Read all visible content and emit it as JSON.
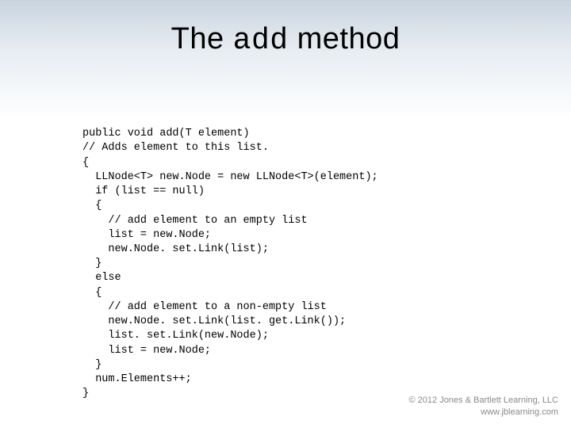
{
  "title": {
    "part1": "The ",
    "code": "add",
    "part2": " method"
  },
  "code_lines": [
    "public void add(T element)",
    "// Adds element to this list.",
    "{",
    "  LLNode<T> new.Node = new LLNode<T>(element);",
    "  if (list == null)",
    "  {",
    "    // add element to an empty list",
    "    list = new.Node;",
    "    new.Node. set.Link(list);",
    "  }",
    "  else",
    "  {",
    "    // add element to a non-empty list",
    "    new.Node. set.Link(list. get.Link());",
    "    list. set.Link(new.Node);",
    "    list = new.Node;",
    "  }",
    "  num.Elements++;",
    "}"
  ],
  "footer": {
    "line1": "© 2012 Jones & Bartlett Learning, LLC",
    "line2": "www.jblearning.com"
  }
}
